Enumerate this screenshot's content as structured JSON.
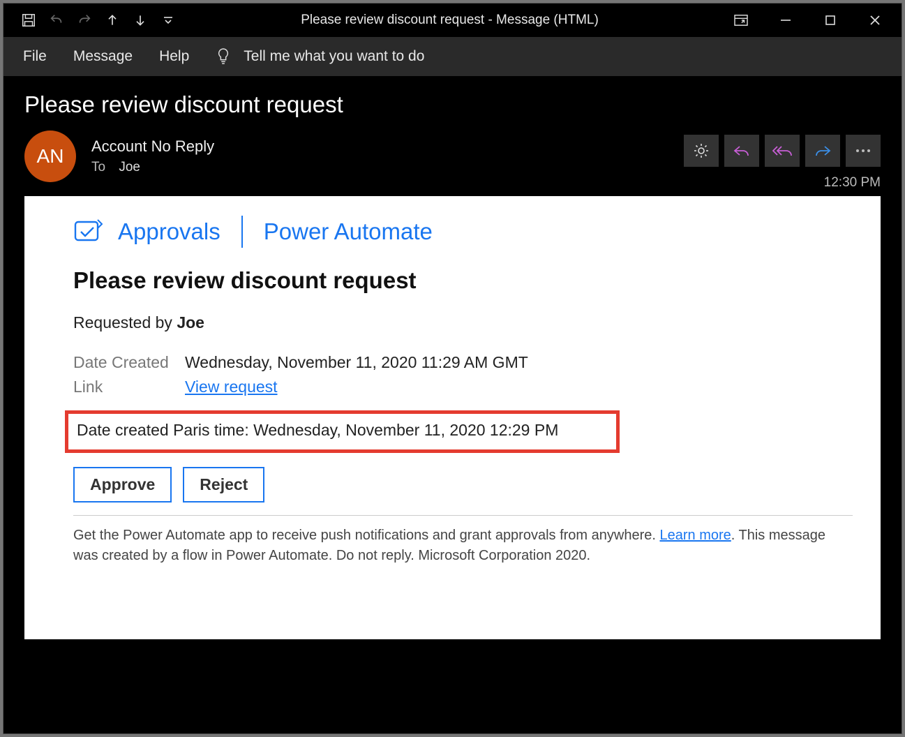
{
  "window": {
    "title": "Please review discount request  -  Message (HTML)"
  },
  "menu": {
    "file": "File",
    "message": "Message",
    "help": "Help",
    "tellme": "Tell me what you want to do"
  },
  "header": {
    "subject": "Please review discount request",
    "avatar_initials": "AN",
    "sender_name": "Account No Reply",
    "to_label": "To",
    "to_name": "Joe",
    "time": "12:30 PM"
  },
  "body": {
    "approvals_label": "Approvals",
    "power_automate_label": "Power Automate",
    "title": "Please review discount request",
    "requested_by_prefix": "Requested by ",
    "requested_by_name": "Joe",
    "date_created_label": "Date Created",
    "date_created_value": "Wednesday, November 11, 2020 11:29 AM GMT",
    "link_label": "Link",
    "link_text": "View request",
    "highlight_text": "Date created Paris time: Wednesday, November 11, 2020 12:29 PM",
    "approve_label": "Approve",
    "reject_label": "Reject",
    "footer_part1": "Get the Power Automate app to receive push notifications and grant approvals from anywhere. ",
    "footer_learn_more": "Learn more",
    "footer_part2": ". This message was created by a flow in Power Automate. Do not reply. Microsoft Corporation 2020."
  }
}
